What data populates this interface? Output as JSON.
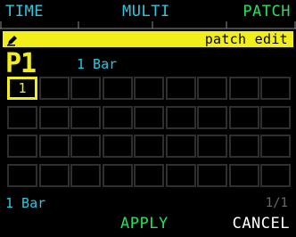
{
  "tabs": {
    "time": "TIME",
    "multi": "MULTI",
    "patch": "PATCH"
  },
  "header": {
    "icon": "pencil-icon",
    "title": "patch edit"
  },
  "patch": {
    "id": "P1",
    "length": "1 Bar"
  },
  "grid": {
    "rows": 4,
    "cols": 9,
    "cells": [
      [
        "1",
        "",
        "",
        "",
        "",
        "",
        "",
        "",
        ""
      ],
      [
        "",
        "",
        "",
        "",
        "",
        "",
        "",
        "",
        ""
      ],
      [
        "",
        "",
        "",
        "",
        "",
        "",
        "",
        "",
        ""
      ],
      [
        "",
        "",
        "",
        "",
        "",
        "",
        "",
        "",
        ""
      ]
    ],
    "selected_cell": "1"
  },
  "footer": {
    "length": "1 Bar",
    "page": "1/1"
  },
  "buttons": {
    "apply": "APPLY",
    "cancel": "CANCEL"
  },
  "colors": {
    "cyan": "#2bc8e0",
    "green": "#25e05a",
    "yellow": "#f2ee1c",
    "grid": "#2f2f2f",
    "background": "#000000"
  }
}
